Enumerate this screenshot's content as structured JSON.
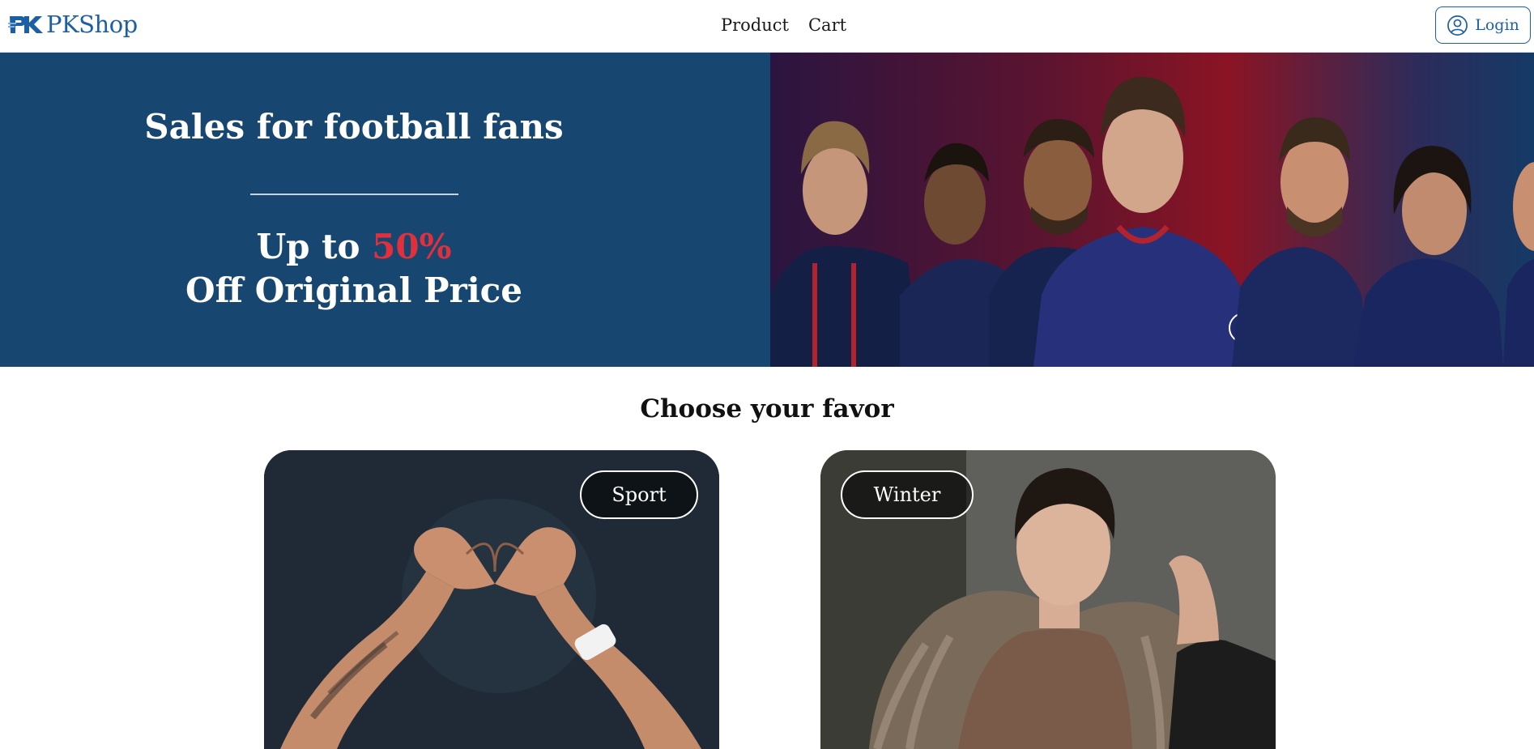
{
  "header": {
    "logo_text": "PKShop",
    "logo_mark_icon": "pk-logo-icon",
    "nav": [
      {
        "label": "Product"
      },
      {
        "label": "Cart"
      }
    ],
    "login": {
      "label": "Login",
      "icon": "user-circle-icon"
    }
  },
  "hero": {
    "title": "Sales for football fans",
    "offer_prefix": "Up to ",
    "offer_highlight": "50%",
    "offer_suffix": "Off Original Price",
    "image": "football-players-photo",
    "colors": {
      "panel": "#174670",
      "highlight": "#e0303c"
    }
  },
  "section": {
    "title": "Choose your favor",
    "cards": [
      {
        "tag": "Sport",
        "image": "heart-hands-photo"
      },
      {
        "tag": "Winter",
        "image": "fur-coat-model-photo"
      }
    ]
  },
  "colors": {
    "brand": "#1d5fa3"
  }
}
